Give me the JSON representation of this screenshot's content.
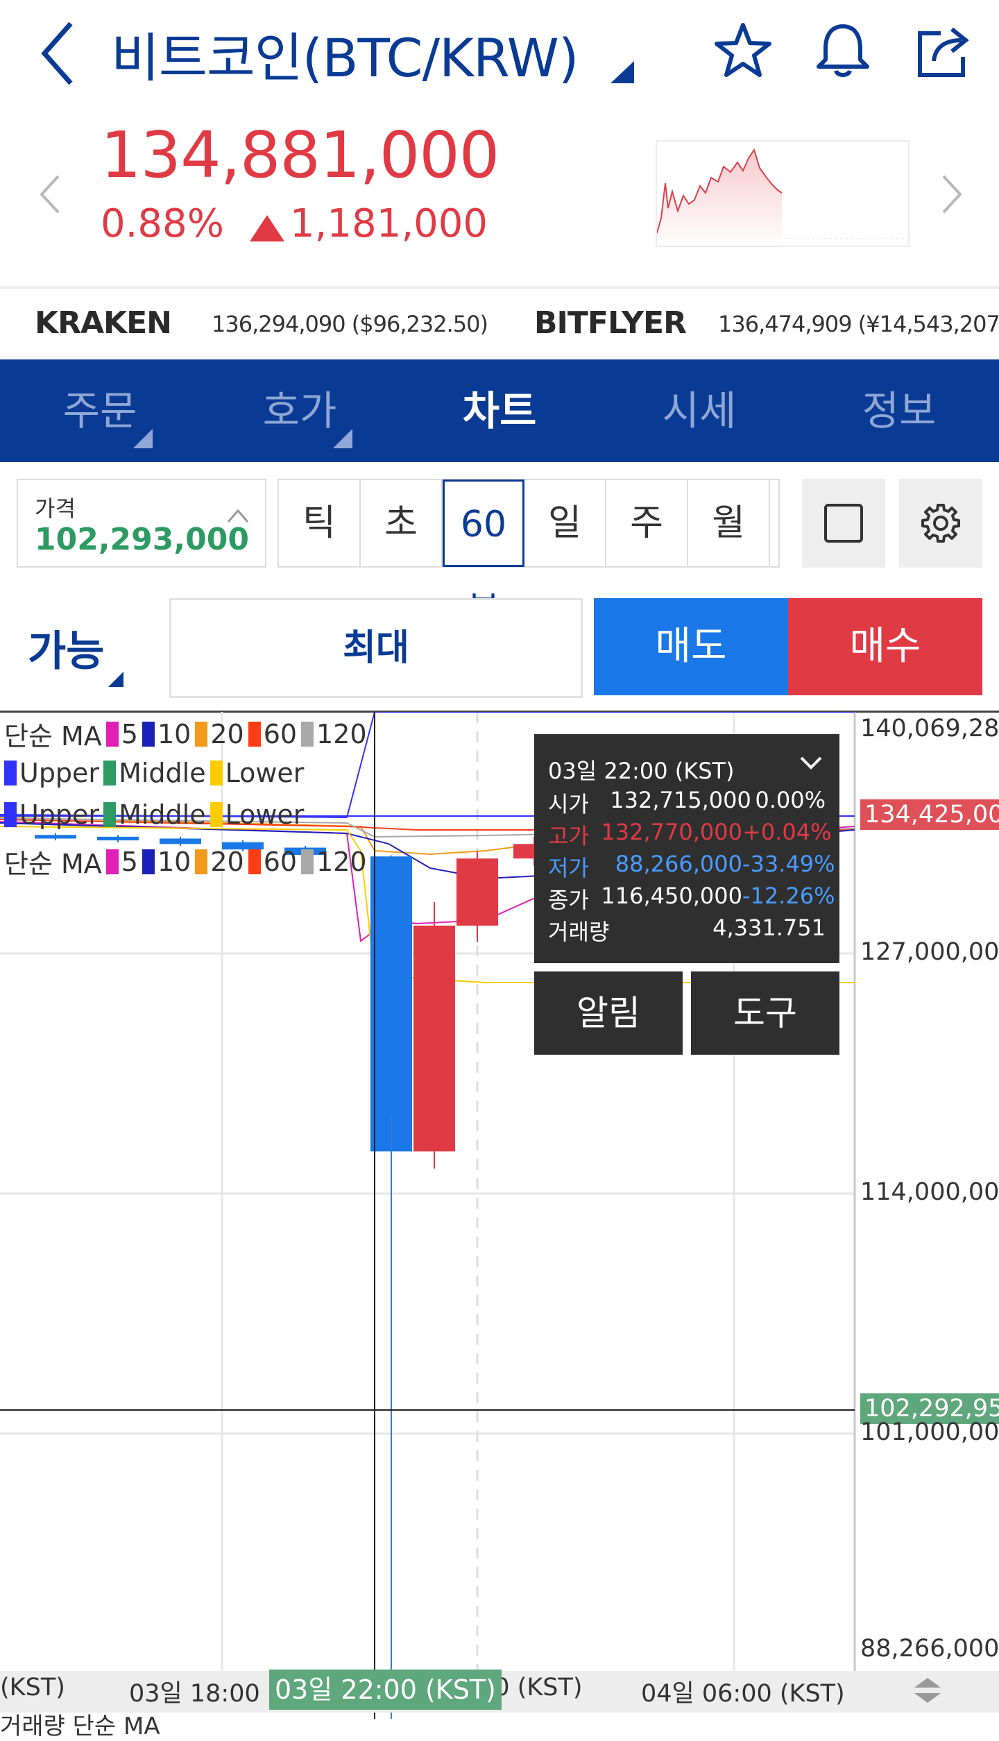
{
  "header": {
    "title": "비트코인(BTC/KRW)",
    "icons": [
      "back-arrow-icon",
      "star-icon",
      "bell-icon",
      "share-icon"
    ]
  },
  "quote": {
    "price": "134,881,000",
    "change_pct": "0.88%",
    "change_amount": "1,181,000",
    "color_up": "#e03a45"
  },
  "exchanges": [
    {
      "name": "KRAKEN",
      "value": "136,294,090 ($96,232.50)"
    },
    {
      "name": "BITFLYER",
      "value": "136,474,909 (¥14,543,207.00)"
    }
  ],
  "tabs": [
    {
      "label": "주문",
      "active": false
    },
    {
      "label": "호가",
      "active": false
    },
    {
      "label": "차트",
      "active": true
    },
    {
      "label": "시세",
      "active": false
    },
    {
      "label": "정보",
      "active": false
    }
  ],
  "controls": {
    "price_label": "가격",
    "price_value": "102,293,000",
    "periods": [
      "틱",
      "초",
      "60분",
      "일",
      "주",
      "월"
    ],
    "selected_period": "60분"
  },
  "order": {
    "avail_label": "가능",
    "max_label": "최대",
    "sell_label": "매도",
    "buy_label": "매수",
    "sell_color": "#1a78e8",
    "buy_color": "#e03a45"
  },
  "legends": {
    "ma": {
      "name": "단순 MA",
      "items": [
        {
          "label": "5",
          "color": "#e01fb4"
        },
        {
          "label": "10",
          "color": "#1a22b8"
        },
        {
          "label": "20",
          "color": "#f29a1a"
        },
        {
          "label": "60",
          "color": "#ff3d14"
        },
        {
          "label": "120",
          "color": "#a8a8a8"
        }
      ]
    },
    "bands": {
      "items": [
        {
          "label": "Upper",
          "color": "#3232ff"
        },
        {
          "label": "Middle",
          "color": "#2e9a63"
        },
        {
          "label": "Lower",
          "color": "#ffcc00"
        }
      ]
    }
  },
  "chart_data": {
    "type": "candlestick",
    "y_labels": [
      "140,069,281",
      "127,000,000",
      "114,000,000",
      "101,000,000",
      "88,266,000"
    ],
    "current_price_tag": "134,425,000",
    "crosshair_price_tag": "102,292,954",
    "ylim": [
      88266000,
      140069281
    ],
    "x_labels": [
      "(KST)",
      "03일 18:00 (K",
      "00 (KST)",
      "04일 06:00 (KST)"
    ],
    "crosshair_time": "03일 22:00 (KST)",
    "candles": [
      {
        "open": 133900000,
        "high": 134000000,
        "low": 133600000,
        "close": 133700000,
        "dir": "down"
      },
      {
        "open": 133800000,
        "high": 133900000,
        "low": 133500000,
        "close": 133600000,
        "dir": "down"
      },
      {
        "open": 133700000,
        "high": 133800000,
        "low": 133300000,
        "close": 133400000,
        "dir": "down"
      },
      {
        "open": 133500000,
        "high": 133600000,
        "low": 133000000,
        "close": 133100000,
        "dir": "down"
      },
      {
        "open": 133200000,
        "high": 133300000,
        "low": 132700000,
        "close": 132800000,
        "dir": "down"
      },
      {
        "open": 132715000,
        "high": 132770000,
        "low": 88266000,
        "close": 116450000,
        "dir": "down"
      },
      {
        "open": 116450000,
        "high": 130200000,
        "low": 115500000,
        "close": 128900000,
        "dir": "up"
      },
      {
        "open": 128900000,
        "high": 133000000,
        "low": 128000000,
        "close": 132600000,
        "dir": "up"
      },
      {
        "open": 132600000,
        "high": 133800000,
        "low": 132200000,
        "close": 133400000,
        "dir": "up"
      },
      {
        "open": 133400000,
        "high": 134100000,
        "low": 133100000,
        "close": 133900000,
        "dir": "up"
      },
      {
        "open": 133900000,
        "high": 134700000,
        "low": 133600000,
        "close": 134300000,
        "dir": "up"
      },
      {
        "open": 134300000,
        "high": 134900000,
        "low": 134000000,
        "close": 134425000,
        "dir": "up"
      }
    ]
  },
  "tooltip": {
    "date": "03일 22:00 (KST)",
    "rows": [
      {
        "label": "시가",
        "value": "132,715,000",
        "pct": "0.00%",
        "color": "#ffffff"
      },
      {
        "label": "고가",
        "value": "132,770,000",
        "pct": "+0.04%",
        "color": "#e03a45"
      },
      {
        "label": "저가",
        "value": "88,266,000",
        "pct": "-33.49%",
        "color": "#4a9bff"
      },
      {
        "label": "종가",
        "value": "116,450,000",
        "pct": "-12.26%",
        "color": "#ffffff"
      },
      {
        "label": "거래량",
        "value": "4,331.751",
        "pct": "",
        "color": "#ffffff"
      }
    ],
    "pct_colors": [
      "#ffffff",
      "#e03a45",
      "#4a9bff",
      "#4a9bff",
      "#ffffff"
    ],
    "alarm_label": "알림",
    "tool_label": "도구"
  },
  "bottom_legend": "거래량 단순 MA"
}
